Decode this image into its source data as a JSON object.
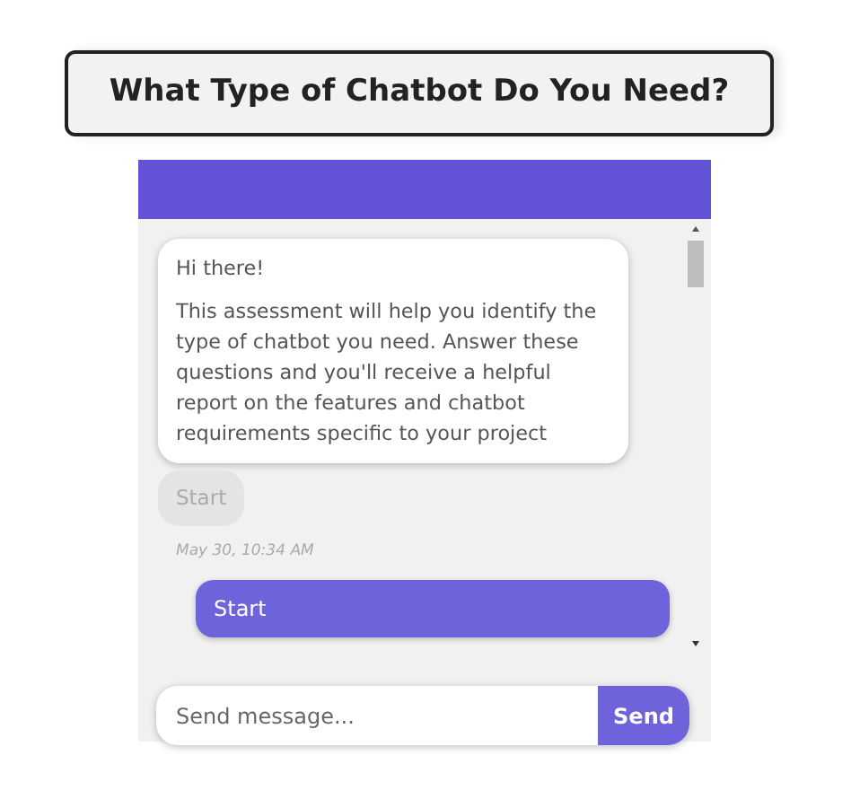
{
  "title": "What Type of Chatbot Do You Need?",
  "messages": [
    {
      "kind": "bot",
      "paragraphs": [
        "Hi there!",
        "This assessment will help you identify the type of chatbot you need. Answer these questions and you'll receive a helpful report on the features and chatbot requirements specific to your project"
      ]
    },
    {
      "kind": "quick-reply",
      "text": "Start",
      "disabled": true
    },
    {
      "kind": "timestamp",
      "text": "May 30, 10:34 AM"
    },
    {
      "kind": "user",
      "text": "Start"
    }
  ],
  "composer": {
    "placeholder": "Send message...",
    "button": "Send"
  }
}
